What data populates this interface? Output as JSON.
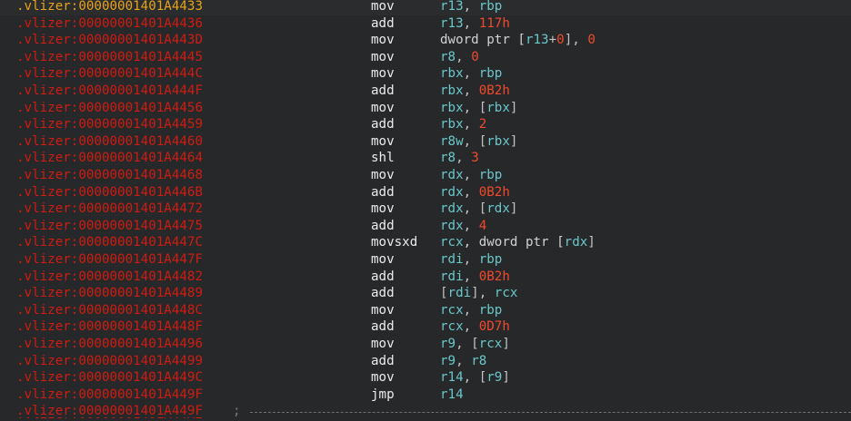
{
  "listing": {
    "rows": [
      {
        "addr": ".vlizer:00000001401A4433",
        "mnem": "mov",
        "ops": [
          {
            "t": "r13",
            "k": "reg"
          },
          {
            "t": ", ",
            "k": "txt"
          },
          {
            "t": "rbp",
            "k": "reg"
          }
        ],
        "current": true
      },
      {
        "addr": ".vlizer:00000001401A4436",
        "mnem": "add",
        "ops": [
          {
            "t": "r13",
            "k": "reg"
          },
          {
            "t": ", ",
            "k": "txt"
          },
          {
            "t": "117h",
            "k": "num"
          }
        ]
      },
      {
        "addr": ".vlizer:00000001401A443D",
        "mnem": "mov",
        "ops": [
          {
            "t": "dword ptr [",
            "k": "ptr"
          },
          {
            "t": "r13",
            "k": "reg"
          },
          {
            "t": "+",
            "k": "txt"
          },
          {
            "t": "0",
            "k": "num"
          },
          {
            "t": "], ",
            "k": "txt"
          },
          {
            "t": "0",
            "k": "num"
          }
        ]
      },
      {
        "addr": ".vlizer:00000001401A4445",
        "mnem": "mov",
        "ops": [
          {
            "t": "r8",
            "k": "reg"
          },
          {
            "t": ", ",
            "k": "txt"
          },
          {
            "t": "0",
            "k": "num"
          }
        ]
      },
      {
        "addr": ".vlizer:00000001401A444C",
        "mnem": "mov",
        "ops": [
          {
            "t": "rbx",
            "k": "reg"
          },
          {
            "t": ", ",
            "k": "txt"
          },
          {
            "t": "rbp",
            "k": "reg"
          }
        ]
      },
      {
        "addr": ".vlizer:00000001401A444F",
        "mnem": "add",
        "ops": [
          {
            "t": "rbx",
            "k": "reg"
          },
          {
            "t": ", ",
            "k": "txt"
          },
          {
            "t": "0B2h",
            "k": "num"
          }
        ]
      },
      {
        "addr": ".vlizer:00000001401A4456",
        "mnem": "mov",
        "ops": [
          {
            "t": "rbx",
            "k": "reg"
          },
          {
            "t": ", [",
            "k": "txt"
          },
          {
            "t": "rbx",
            "k": "reg"
          },
          {
            "t": "]",
            "k": "txt"
          }
        ]
      },
      {
        "addr": ".vlizer:00000001401A4459",
        "mnem": "add",
        "ops": [
          {
            "t": "rbx",
            "k": "reg"
          },
          {
            "t": ", ",
            "k": "txt"
          },
          {
            "t": "2",
            "k": "num"
          }
        ]
      },
      {
        "addr": ".vlizer:00000001401A4460",
        "mnem": "mov",
        "ops": [
          {
            "t": "r8w",
            "k": "reg"
          },
          {
            "t": ", [",
            "k": "txt"
          },
          {
            "t": "rbx",
            "k": "reg"
          },
          {
            "t": "]",
            "k": "txt"
          }
        ]
      },
      {
        "addr": ".vlizer:00000001401A4464",
        "mnem": "shl",
        "ops": [
          {
            "t": "r8",
            "k": "reg"
          },
          {
            "t": ", ",
            "k": "txt"
          },
          {
            "t": "3",
            "k": "num"
          }
        ]
      },
      {
        "addr": ".vlizer:00000001401A4468",
        "mnem": "mov",
        "ops": [
          {
            "t": "rdx",
            "k": "reg"
          },
          {
            "t": ", ",
            "k": "txt"
          },
          {
            "t": "rbp",
            "k": "reg"
          }
        ]
      },
      {
        "addr": ".vlizer:00000001401A446B",
        "mnem": "add",
        "ops": [
          {
            "t": "rdx",
            "k": "reg"
          },
          {
            "t": ", ",
            "k": "txt"
          },
          {
            "t": "0B2h",
            "k": "num"
          }
        ]
      },
      {
        "addr": ".vlizer:00000001401A4472",
        "mnem": "mov",
        "ops": [
          {
            "t": "rdx",
            "k": "reg"
          },
          {
            "t": ", [",
            "k": "txt"
          },
          {
            "t": "rdx",
            "k": "reg"
          },
          {
            "t": "]",
            "k": "txt"
          }
        ]
      },
      {
        "addr": ".vlizer:00000001401A4475",
        "mnem": "add",
        "ops": [
          {
            "t": "rdx",
            "k": "reg"
          },
          {
            "t": ", ",
            "k": "txt"
          },
          {
            "t": "4",
            "k": "num"
          }
        ]
      },
      {
        "addr": ".vlizer:00000001401A447C",
        "mnem": "movsxd",
        "ops": [
          {
            "t": "rcx",
            "k": "reg"
          },
          {
            "t": ", dword ptr [",
            "k": "ptr"
          },
          {
            "t": "rdx",
            "k": "reg"
          },
          {
            "t": "]",
            "k": "txt"
          }
        ]
      },
      {
        "addr": ".vlizer:00000001401A447F",
        "mnem": "mov",
        "ops": [
          {
            "t": "rdi",
            "k": "reg"
          },
          {
            "t": ", ",
            "k": "txt"
          },
          {
            "t": "rbp",
            "k": "reg"
          }
        ]
      },
      {
        "addr": ".vlizer:00000001401A4482",
        "mnem": "add",
        "ops": [
          {
            "t": "rdi",
            "k": "reg"
          },
          {
            "t": ", ",
            "k": "txt"
          },
          {
            "t": "0B2h",
            "k": "num"
          }
        ]
      },
      {
        "addr": ".vlizer:00000001401A4489",
        "mnem": "add",
        "ops": [
          {
            "t": "[",
            "k": "txt"
          },
          {
            "t": "rdi",
            "k": "reg"
          },
          {
            "t": "], ",
            "k": "txt"
          },
          {
            "t": "rcx",
            "k": "reg"
          }
        ]
      },
      {
        "addr": ".vlizer:00000001401A448C",
        "mnem": "mov",
        "ops": [
          {
            "t": "rcx",
            "k": "reg"
          },
          {
            "t": ", ",
            "k": "txt"
          },
          {
            "t": "rbp",
            "k": "reg"
          }
        ]
      },
      {
        "addr": ".vlizer:00000001401A448F",
        "mnem": "add",
        "ops": [
          {
            "t": "rcx",
            "k": "reg"
          },
          {
            "t": ", ",
            "k": "txt"
          },
          {
            "t": "0D7h",
            "k": "num"
          }
        ]
      },
      {
        "addr": ".vlizer:00000001401A4496",
        "mnem": "mov",
        "ops": [
          {
            "t": "r9",
            "k": "reg"
          },
          {
            "t": ", [",
            "k": "txt"
          },
          {
            "t": "rcx",
            "k": "reg"
          },
          {
            "t": "]",
            "k": "txt"
          }
        ]
      },
      {
        "addr": ".vlizer:00000001401A4499",
        "mnem": "add",
        "ops": [
          {
            "t": "r9",
            "k": "reg"
          },
          {
            "t": ", ",
            "k": "txt"
          },
          {
            "t": "r8",
            "k": "reg"
          }
        ]
      },
      {
        "addr": ".vlizer:00000001401A449C",
        "mnem": "mov",
        "ops": [
          {
            "t": "r14",
            "k": "reg"
          },
          {
            "t": ", [",
            "k": "txt"
          },
          {
            "t": "r9",
            "k": "reg"
          },
          {
            "t": "]",
            "k": "txt"
          }
        ]
      },
      {
        "addr": ".vlizer:00000001401A449F",
        "mnem": "jmp",
        "ops": [
          {
            "t": "r14",
            "k": "reg"
          }
        ]
      }
    ],
    "separator": {
      "addr": ".vlizer:00000001401A449F",
      "comment": ";"
    }
  },
  "colors": {
    "background": "#26282a",
    "address": "#d01c12",
    "current_address": "#e8a318",
    "mnemonic": "#ececec",
    "register": "#6bc7ca",
    "number": "#f14a2c"
  }
}
